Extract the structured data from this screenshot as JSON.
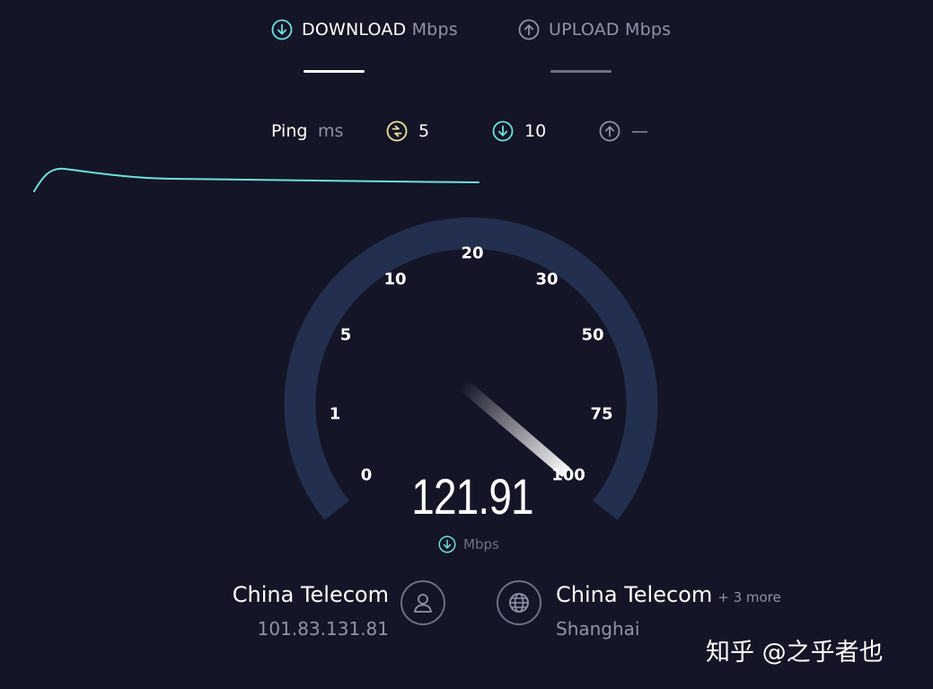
{
  "tabs": {
    "download": {
      "label": "DOWNLOAD",
      "unit": "Mbps",
      "active": true
    },
    "upload": {
      "label": "UPLOAD",
      "unit": "Mbps",
      "active": false
    }
  },
  "ping": {
    "label": "Ping",
    "unit": "ms",
    "idle": "5",
    "download": "10",
    "upload": "—"
  },
  "gauge": {
    "labels": [
      "0",
      "1",
      "5",
      "10",
      "20",
      "30",
      "50",
      "75",
      "100"
    ],
    "speed": "121.91",
    "unit": "Mbps"
  },
  "isp": {
    "name": "China Telecom",
    "ip": "101.83.131.81"
  },
  "server": {
    "name": "China Telecom",
    "more": "+ 3 more",
    "location": "Shanghai"
  },
  "watermark": "知乎 @之乎者也",
  "colors": {
    "background": "#141526",
    "accent": "#6ee0e0",
    "idle_ping": "#f0e3a0",
    "muted": "#9193a8",
    "gauge_track": "#232f4e"
  },
  "icons": {
    "download": "arrow-down-circle",
    "upload": "arrow-up-circle",
    "idle": "idle-latency",
    "user": "user",
    "server": "globe"
  }
}
